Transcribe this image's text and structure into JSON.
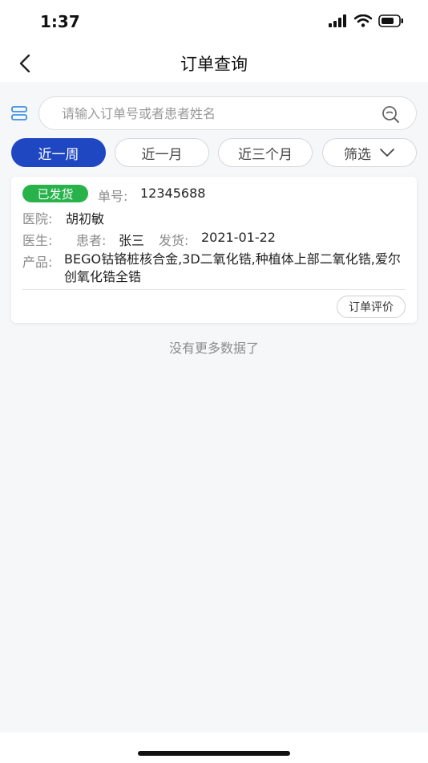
{
  "status_bar": {
    "time": "1:37"
  },
  "nav": {
    "title": "订单查询"
  },
  "search": {
    "placeholder": "请输入订单号或者患者姓名"
  },
  "filters": [
    {
      "label": "近一周",
      "active": true
    },
    {
      "label": "近一月",
      "active": false
    },
    {
      "label": "近三个月",
      "active": false
    },
    {
      "label": "筛选",
      "active": false
    }
  ],
  "orders": [
    {
      "status": "已发货",
      "status_color": "#27b34a",
      "order_label": "单号:",
      "order_no": "12345688",
      "hospital_label": "医院:",
      "hospital": "胡初敏",
      "doctor_label": "医生:",
      "doctor": "",
      "patient_label": "患者:",
      "patient": "张三",
      "ship_label": "发货:",
      "ship_date": "2021-01-22",
      "product_label": "产品:",
      "products": "BEGO钴铬桩核合金,3D二氧化锆,种植体上部二氧化锆,爱尔创氧化锆全锆",
      "review_button": "订单评价"
    }
  ],
  "footer": {
    "no_more": "没有更多数据了"
  },
  "colors": {
    "accent": "#1f47c2",
    "shipped": "#27b34a"
  }
}
